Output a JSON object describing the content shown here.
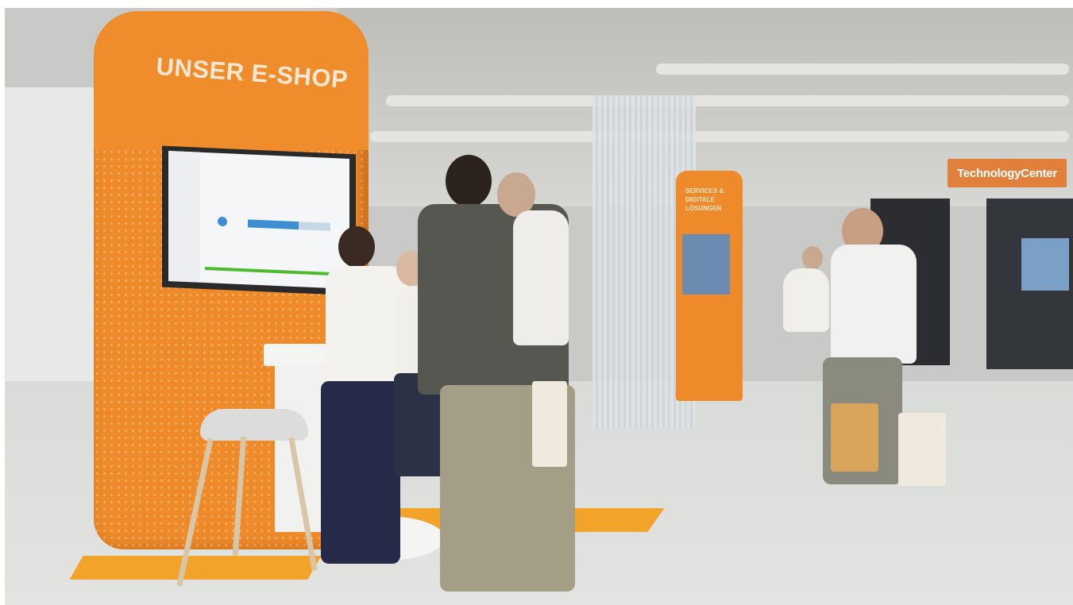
{
  "photo": {
    "tower_title": "UNSER E-SHOP",
    "tech_center_sign": "TechnologyCenter"
  },
  "colors": {
    "accent_orange": "#ee8a2a",
    "floor": "#dfe0de",
    "stripe_yellow": "#f2a32a"
  }
}
